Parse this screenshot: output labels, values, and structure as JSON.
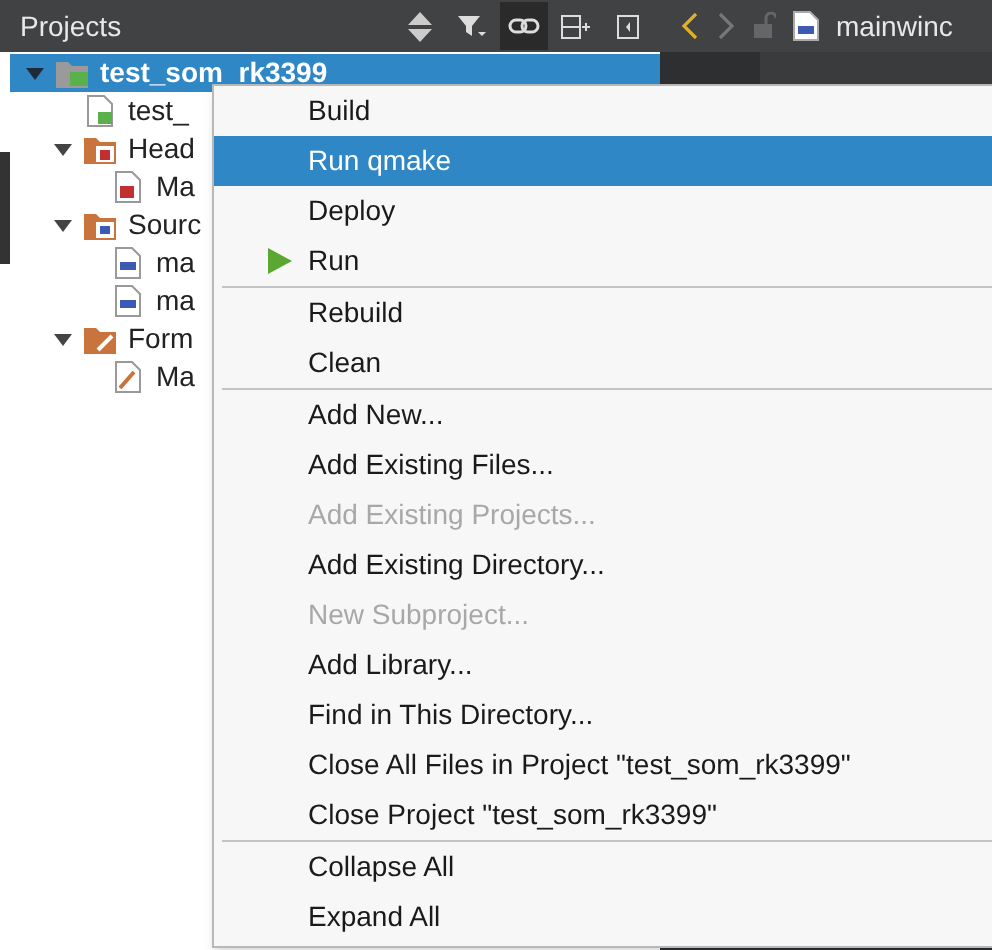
{
  "projects_pane": {
    "title": "Projects",
    "toolbar": [
      {
        "kind": "sort",
        "checked": false
      },
      {
        "kind": "filter",
        "checked": false
      },
      {
        "kind": "link",
        "checked": true
      },
      {
        "kind": "split",
        "checked": false
      },
      {
        "kind": "close",
        "checked": false
      }
    ],
    "tree": [
      {
        "label": "test_som_rk3399",
        "kind": "project",
        "selected": true,
        "expanded": true,
        "children": [
          {
            "label": "test_",
            "kind": "pro",
            "selected": false
          },
          {
            "label": "Head",
            "kind": "headers",
            "selected": false,
            "expanded": true,
            "children": [
              {
                "label": "Ma",
                "kind": "h",
                "selected": false
              }
            ]
          },
          {
            "label": "Sourc",
            "kind": "sources",
            "selected": false,
            "expanded": true,
            "children": [
              {
                "label": "ma",
                "kind": "cpp",
                "selected": false
              },
              {
                "label": "ma",
                "kind": "cpp",
                "selected": false
              }
            ]
          },
          {
            "label": "Form",
            "kind": "forms",
            "selected": false,
            "expanded": true,
            "children": [
              {
                "label": "Ma",
                "kind": "ui",
                "selected": false
              }
            ]
          }
        ]
      }
    ]
  },
  "editor": {
    "tab": "mainwinc"
  },
  "context_menu": [
    {
      "kind": "item",
      "label": "Build",
      "disabled": false,
      "selected": false
    },
    {
      "kind": "item",
      "label": "Run qmake",
      "disabled": false,
      "selected": true
    },
    {
      "kind": "item",
      "label": "Deploy",
      "disabled": false,
      "selected": false
    },
    {
      "kind": "run",
      "label": "Run",
      "disabled": false,
      "selected": false
    },
    {
      "kind": "separator"
    },
    {
      "kind": "item",
      "label": "Rebuild",
      "disabled": false,
      "selected": false
    },
    {
      "kind": "item",
      "label": "Clean",
      "disabled": false,
      "selected": false
    },
    {
      "kind": "separator"
    },
    {
      "kind": "item",
      "label": "Add New...",
      "disabled": false,
      "selected": false
    },
    {
      "kind": "item",
      "label": "Add Existing Files...",
      "disabled": false,
      "selected": false
    },
    {
      "kind": "item",
      "label": "Add Existing Projects...",
      "disabled": true,
      "selected": false
    },
    {
      "kind": "item",
      "label": "Add Existing Directory...",
      "disabled": false,
      "selected": false
    },
    {
      "kind": "item",
      "label": "New Subproject...",
      "disabled": true,
      "selected": false
    },
    {
      "kind": "item",
      "label": "Add Library...",
      "disabled": false,
      "selected": false
    },
    {
      "kind": "item",
      "label": "Find in This Directory...",
      "disabled": false,
      "selected": false
    },
    {
      "kind": "item",
      "label": "Close All Files in Project \"test_som_rk3399\"",
      "disabled": false,
      "selected": false
    },
    {
      "kind": "item",
      "label": "Close Project \"test_som_rk3399\"",
      "disabled": false,
      "selected": false
    },
    {
      "kind": "separator"
    },
    {
      "kind": "item",
      "label": "Collapse All",
      "disabled": false,
      "selected": false
    },
    {
      "kind": "item",
      "label": "Expand All",
      "disabled": false,
      "selected": false
    }
  ]
}
